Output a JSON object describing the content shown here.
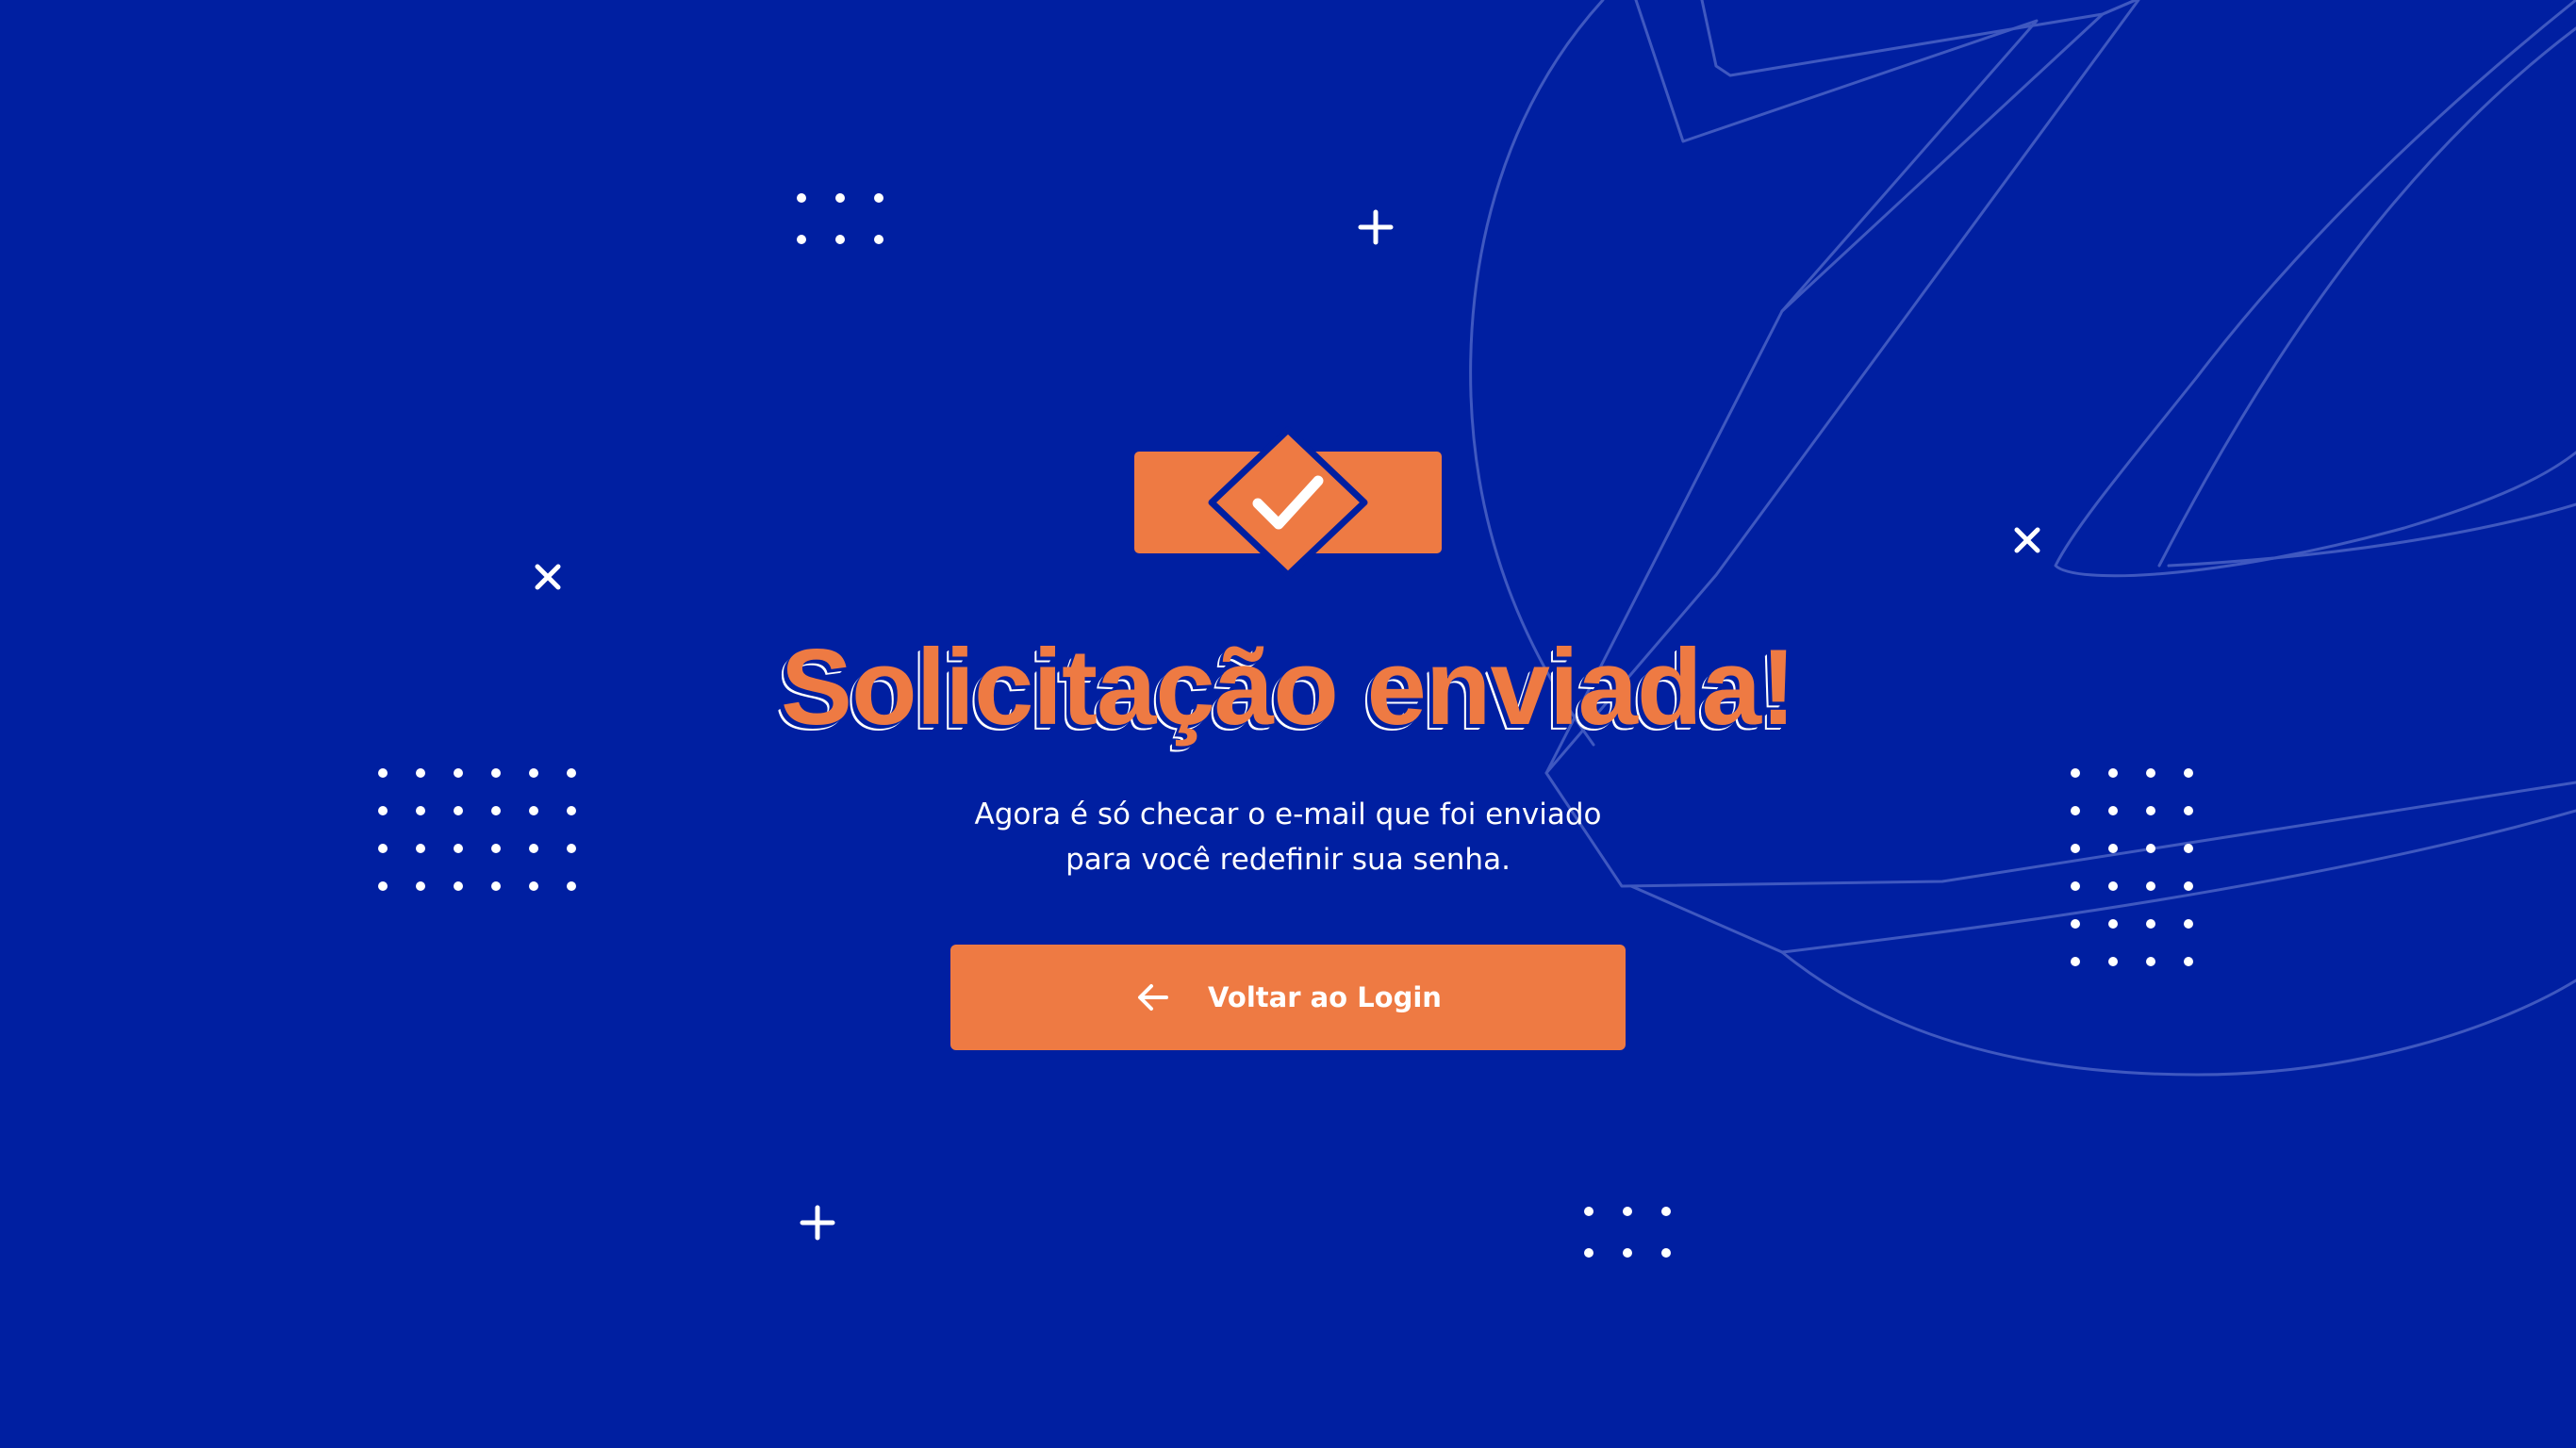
{
  "confirmation": {
    "title": "Solicitação enviada!",
    "message_line1": "Agora é só checar o e-mail que foi enviado",
    "message_line2": "para você redefinir sua senha.",
    "back_button_label": "Voltar ao Login"
  },
  "icons": {
    "status": "check-badge-icon",
    "button": "arrow-left-icon",
    "decorations": [
      "plus-icon",
      "close-icon",
      "dot-grid"
    ]
  },
  "colors": {
    "background": "#001fa1",
    "accent": "#ee7a43",
    "text": "#ffffff"
  }
}
